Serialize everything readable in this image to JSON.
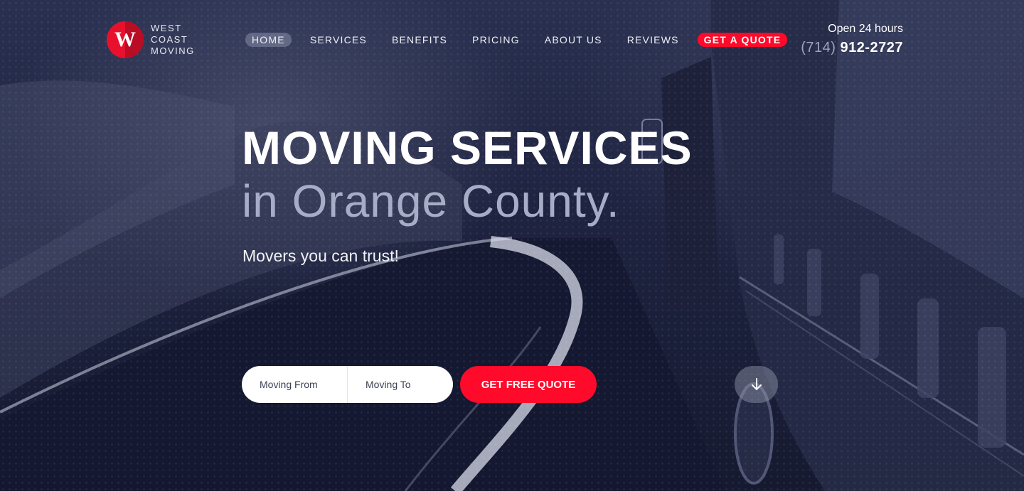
{
  "brand": {
    "logo_letter": "W",
    "name_lines": [
      "WEST",
      "COAST",
      "MOVING"
    ],
    "color": "#e8112d"
  },
  "nav": {
    "items": [
      {
        "label": "HOME",
        "active": true
      },
      {
        "label": "SERVICES"
      },
      {
        "label": "BENEFITS"
      },
      {
        "label": "PRICING"
      },
      {
        "label": "ABOUT US"
      },
      {
        "label": "REVIEWS"
      }
    ],
    "quote_label": "GET A QUOTE",
    "accent": "#ff0a2a"
  },
  "contact": {
    "hours": "Open 24 hours",
    "phone_area": "(714)",
    "phone_number": "912-2727"
  },
  "hero": {
    "headline": "MOVING SERVICES",
    "subheadline": "in Orange County.",
    "tagline": "Movers you can trust!"
  },
  "form": {
    "from_placeholder": "Moving From",
    "to_placeholder": "Moving To",
    "cta_label": "GET FREE QUOTE"
  },
  "icons": {
    "scroll": "arrow-down-icon"
  }
}
